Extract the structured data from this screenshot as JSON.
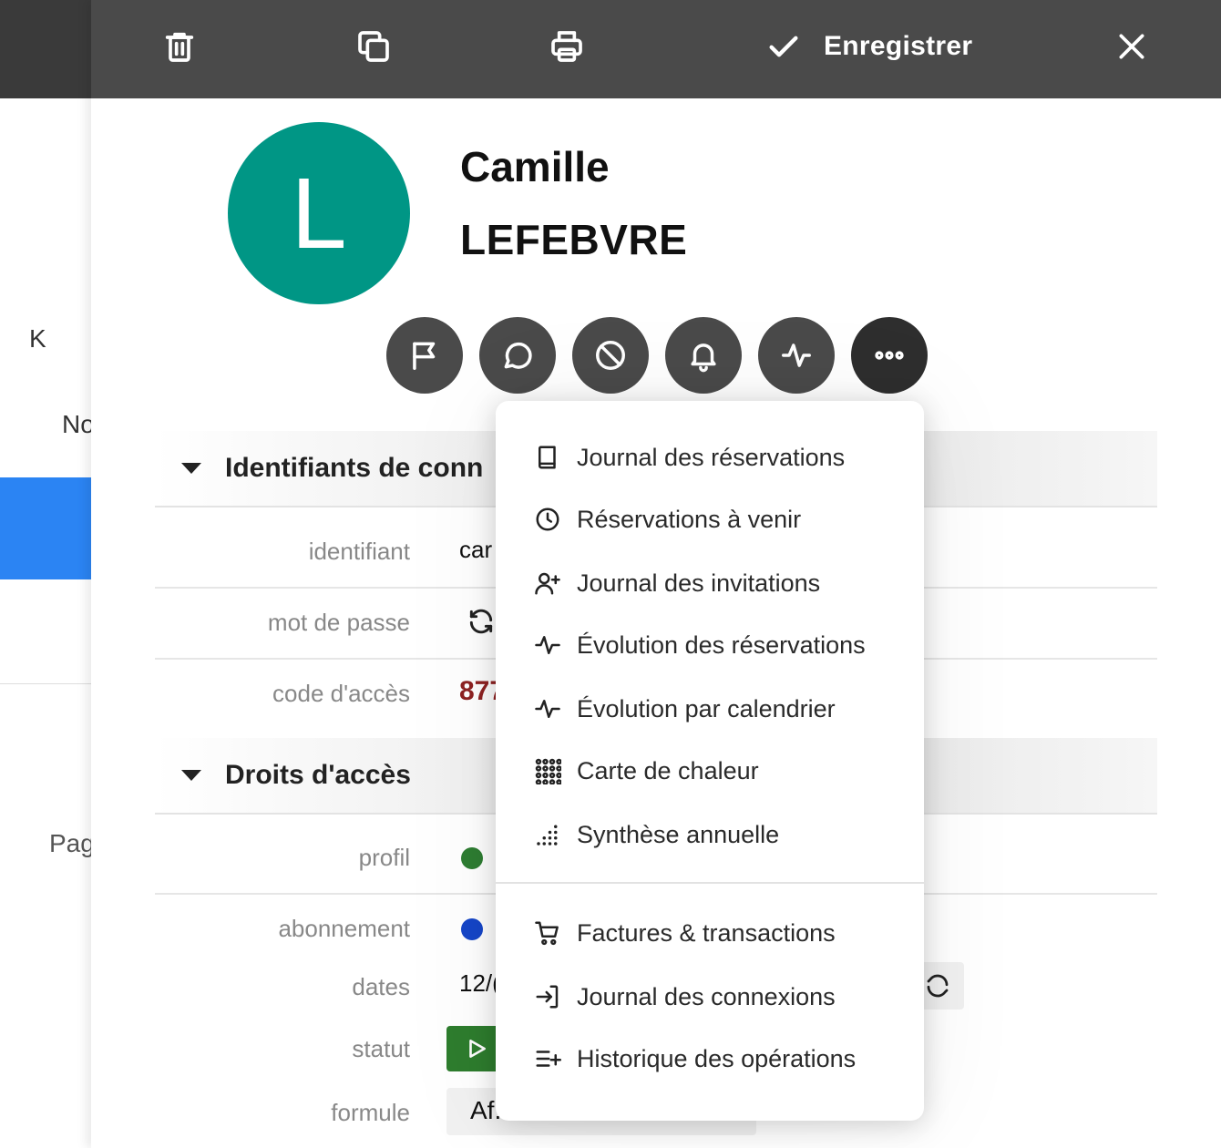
{
  "background": {
    "left_letter": "K",
    "left_text_1": "No",
    "left_text_2": "Pag"
  },
  "toolbar": {
    "save_label": "Enregistrer"
  },
  "user": {
    "initial": "L",
    "first_name": "Camille",
    "last_name": "LEFEBVRE",
    "avatar_color": "#009685"
  },
  "sections": {
    "credentials": {
      "title": "Identifiants de conn",
      "rows": {
        "identifiant_label": "identifiant",
        "identifiant_value": "car",
        "password_label": "mot de passe",
        "access_code_label": "code d'accès",
        "access_code_value": "877"
      }
    },
    "rights": {
      "title": "Droits d'accès",
      "rows": {
        "profile_label": "profil",
        "profile_dot_color": "#2e7d32",
        "subscription_label": "abonnement",
        "subscription_dot_color": "#1646c8",
        "dates_label": "dates",
        "dates_value": "12/(",
        "status_label": "statut",
        "status_color": "#2e7d2e",
        "formula_label": "formule",
        "formula_value": "Af."
      }
    }
  },
  "menu": {
    "items": [
      {
        "label": "Journal des réservations",
        "icon": "book-icon"
      },
      {
        "label": "Réservations à venir",
        "icon": "clock-icon"
      },
      {
        "label": "Journal des invitations",
        "icon": "user-plus-icon"
      },
      {
        "label": "Évolution des réservations",
        "icon": "activity-icon"
      },
      {
        "label": "Évolution par calendrier",
        "icon": "activity-icon"
      },
      {
        "label": "Carte de chaleur",
        "icon": "grid-dots-icon"
      },
      {
        "label": "Synthèse annuelle",
        "icon": "dots-chart-icon"
      },
      {
        "label": "Factures & transactions",
        "icon": "cart-icon"
      },
      {
        "label": "Journal des connexions",
        "icon": "login-icon"
      },
      {
        "label": "Historique des opérations",
        "icon": "list-plus-icon"
      }
    ]
  },
  "colors": {
    "toolbar_bg": "#4a4a4a",
    "action_button_bg": "#4a4a4a",
    "left_nav_active": "#2b84f3",
    "access_code_color": "#8e2222"
  }
}
